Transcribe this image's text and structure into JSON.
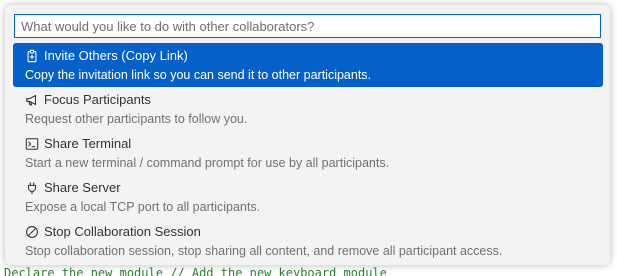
{
  "editor": {
    "code_line": "Declare the new module // Add the new keyboard module"
  },
  "palette": {
    "placeholder": "What would you like to do with other collaborators?",
    "selected_color": "#0660c9",
    "items": [
      {
        "icon": "copy-link-icon",
        "label": "Invite Others (Copy Link)",
        "description": "Copy the invitation link so you can send it to other participants.",
        "selected": true
      },
      {
        "icon": "megaphone-icon",
        "label": "Focus Participants",
        "description": "Request other participants to follow you.",
        "selected": false
      },
      {
        "icon": "terminal-icon",
        "label": "Share Terminal",
        "description": "Start a new terminal / command prompt for use by all participants.",
        "selected": false
      },
      {
        "icon": "plug-icon",
        "label": "Share Server",
        "description": "Expose a local TCP port to all participants.",
        "selected": false
      },
      {
        "icon": "circle-slash-icon",
        "label": "Stop Collaboration Session",
        "description": "Stop collaboration session, stop sharing all content, and remove all participant access.",
        "selected": false
      }
    ]
  }
}
